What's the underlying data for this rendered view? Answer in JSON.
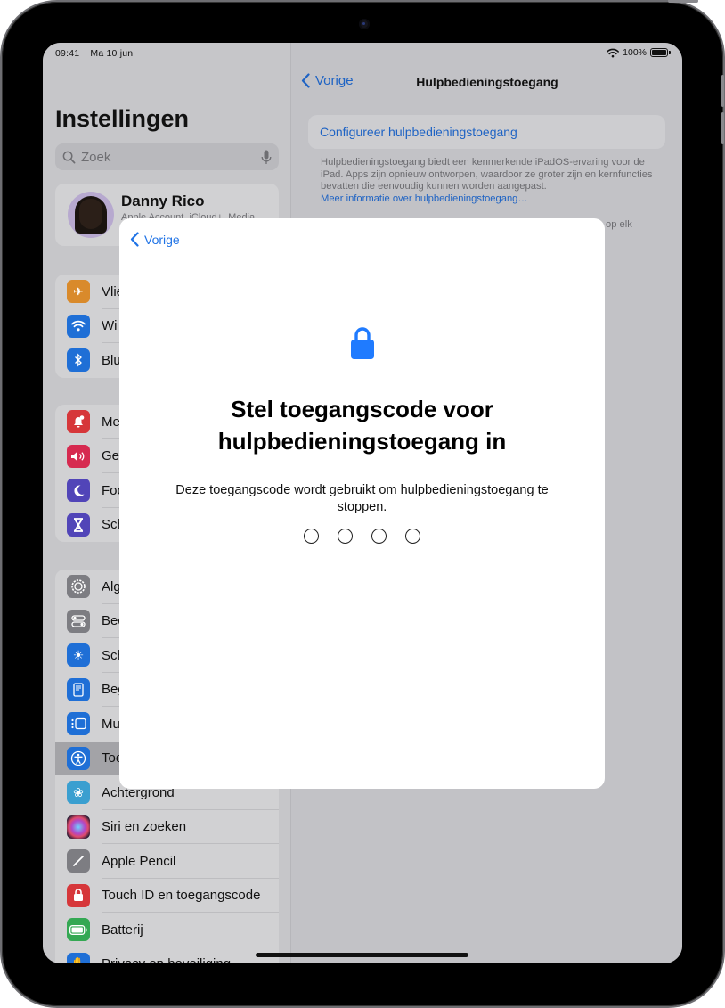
{
  "status_bar": {
    "time": "09:41",
    "date": "Ma 10 jun",
    "battery": "100%",
    "battery_level": 1.0
  },
  "sidebar": {
    "title": "Instellingen",
    "search": {
      "placeholder": "Zoek"
    },
    "profile": {
      "name": "Danny Rico",
      "subtitle": "Apple Account, iCloud+, Media"
    },
    "groups": [
      {
        "items": [
          {
            "label": "Vlie",
            "icon": "airplane-icon",
            "color": "#d98a2b"
          },
          {
            "label": "Wi",
            "icon": "wifi-icon",
            "color": "#1f6fd6"
          },
          {
            "label": "Blu",
            "icon": "bluetooth-icon",
            "color": "#1f6fd6"
          }
        ]
      },
      {
        "items": [
          {
            "label": "Me",
            "icon": "notifications-icon",
            "color": "#d6373a"
          },
          {
            "label": "Ge",
            "icon": "sound-icon",
            "color": "#d62a50"
          },
          {
            "label": "Foc",
            "icon": "focus-moon-icon",
            "color": "#5145b8"
          },
          {
            "label": "Sch",
            "icon": "screen-time-icon",
            "color": "#5145b8"
          }
        ]
      },
      {
        "items": [
          {
            "label": "Alg",
            "icon": "gear-icon",
            "color": "#7d7d82"
          },
          {
            "label": "Bed",
            "icon": "control-center-icon",
            "color": "#7d7d82"
          },
          {
            "label": "Sch",
            "icon": "brightness-icon",
            "color": "#1f6fd6"
          },
          {
            "label": "Beg",
            "icon": "home-screen-icon",
            "color": "#1f6fd6"
          },
          {
            "label": "Mu",
            "icon": "multitasking-icon",
            "color": "#1f6fd6"
          },
          {
            "label": "Toe",
            "icon": "accessibility-icon",
            "color": "#1f6fd6",
            "selected": true
          },
          {
            "label": "Achtergrond",
            "icon": "wallpaper-icon",
            "color": "#3a9fd0"
          },
          {
            "label": "Siri en zoeken",
            "icon": "siri-icon",
            "color": "#2a2340"
          },
          {
            "label": "Apple Pencil",
            "icon": "pencil-icon",
            "color": "#7d7d82"
          },
          {
            "label": "Touch ID en toegangscode",
            "icon": "lock-icon",
            "color": "#d6373a"
          },
          {
            "label": "Batterij",
            "icon": "battery-icon",
            "color": "#34a853"
          },
          {
            "label": "Privacy en beveiliging",
            "icon": "privacy-hand-icon",
            "color": "#1f6fd6"
          }
        ]
      }
    ]
  },
  "detail": {
    "back_label": "Vorige",
    "title": "Hulpbedieningstoegang",
    "configure_label": "Configureer hulpbedieningstoegang",
    "description": "Hulpbedieningstoegang biedt een kenmerkende iPadOS-ervaring voor de iPad. Apps zijn opnieuw ontworpen, waardoor ze groter zijn en kernfuncties bevatten die eenvoudig kunnen worden aangepast.",
    "more_info_link": "Meer informatie over hulpbedieningstoegang…",
    "partial_text": "op elk"
  },
  "modal": {
    "back_label": "Vorige",
    "title": "Stel toegangscode voor hulpbedieningstoegang in",
    "message": "Deze toegangscode wordt gebruikt om hulpbedieningstoegang te stoppen.",
    "passcode_length": 4,
    "digits_entered": 0
  },
  "colors": {
    "accent": "#1f73e6",
    "dim_link": "#1e63c4"
  }
}
